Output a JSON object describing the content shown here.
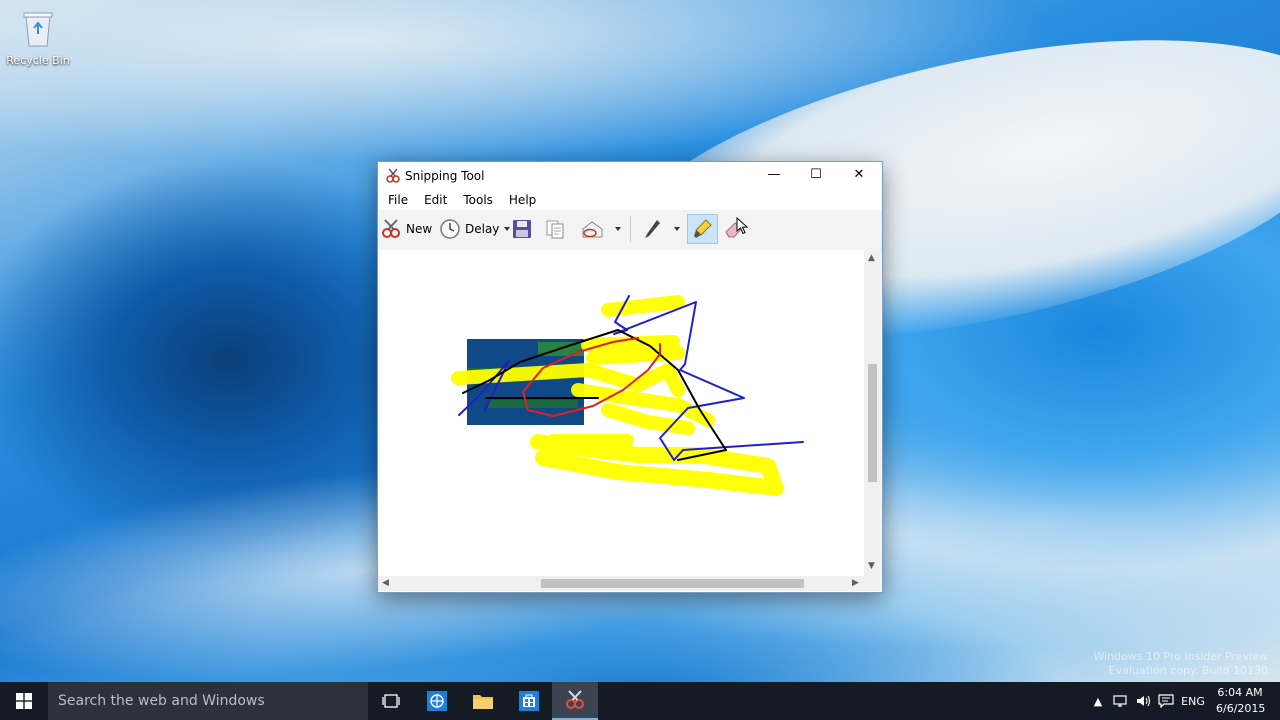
{
  "desktop": {
    "icons": [
      {
        "label": "Recycle Bin"
      }
    ],
    "watermark": {
      "line1": "Windows 10 Pro Insider Preview",
      "line2": "Evaluation copy. Build 10130"
    }
  },
  "window": {
    "title": "Snipping Tool",
    "caption": {
      "minimize": "—",
      "maximize": "☐",
      "close": "✕"
    },
    "menu": [
      "File",
      "Edit",
      "Tools",
      "Help"
    ],
    "toolbar": {
      "new_label": "New",
      "delay_label": "Delay",
      "active_tool": "highlighter"
    },
    "snip": {
      "highlight_color": "#ffff00",
      "pen_colors": [
        "#1f1fcc",
        "#000000",
        "#e02020"
      ]
    }
  },
  "taskbar": {
    "search_placeholder": "Search the web and Windows",
    "pinned": [
      "task-view",
      "edge",
      "file-explorer",
      "store",
      "snipping-tool"
    ],
    "tray": {
      "language": "ENG"
    },
    "clock": {
      "time": "6:04 AM",
      "date": "6/6/2015"
    }
  }
}
